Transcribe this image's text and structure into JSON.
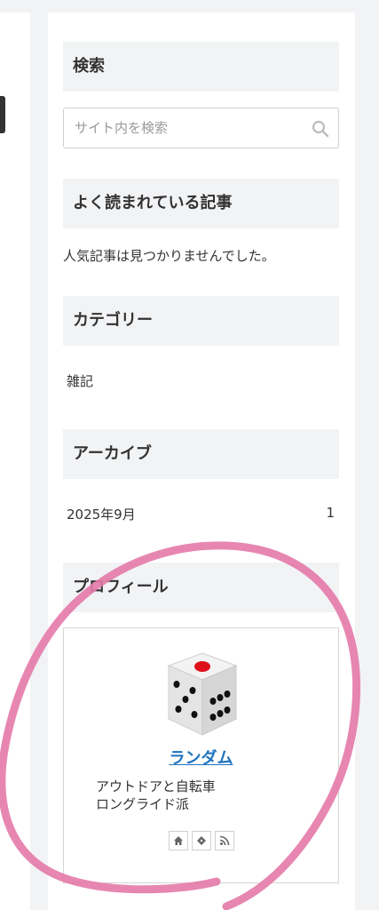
{
  "sidebar": {
    "search": {
      "title": "検索",
      "placeholder": "サイト内を検索"
    },
    "popular": {
      "title": "よく読まれている記事",
      "empty_text": "人気記事は見つかりませんでした。"
    },
    "categories": {
      "title": "カテゴリー",
      "items": [
        {
          "label": "雑記"
        }
      ]
    },
    "archives": {
      "title": "アーカイブ",
      "items": [
        {
          "label": "2025年9月",
          "count": "1"
        }
      ]
    },
    "profile": {
      "title": "プロフィール",
      "avatar_icon": "dice-icon",
      "name": "ランダム",
      "description_lines": [
        "アウトドアと自転車",
        "ロングライド派"
      ],
      "social_icons": [
        "home-icon",
        "feedly-icon",
        "rss-icon"
      ]
    }
  },
  "annotation": {
    "color": "#e47aa9",
    "shape": "hand-drawn-circle"
  }
}
